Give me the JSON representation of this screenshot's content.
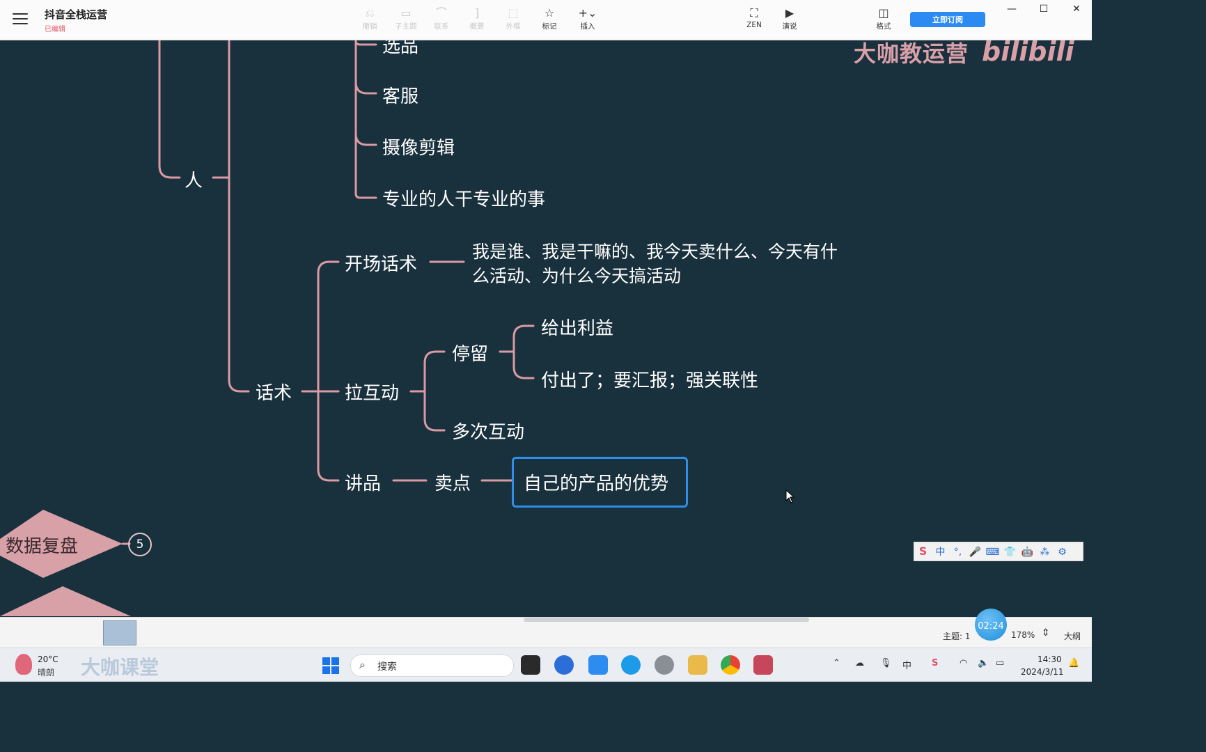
{
  "app": {
    "title": "抖音全栈运营",
    "status": "已编辑",
    "subscribe_label": "立即订阅"
  },
  "toolbar": {
    "items": [
      {
        "label": "撤销",
        "icon": "undo-icon",
        "glyph": "⎌"
      },
      {
        "label": "子主题",
        "icon": "subtopic-icon",
        "glyph": "▭"
      },
      {
        "label": "联系",
        "icon": "relation-icon",
        "glyph": "⌒"
      },
      {
        "label": "概要",
        "icon": "summary-icon",
        "glyph": "]"
      },
      {
        "label": "外框",
        "icon": "boundary-icon",
        "glyph": "⬚"
      },
      {
        "label": "标记",
        "icon": "star-icon",
        "glyph": "☆"
      },
      {
        "label": "插入",
        "icon": "plus-icon",
        "glyph": "+⌄"
      },
      {
        "label": "ZEN",
        "icon": "zen-fullscreen-icon",
        "glyph": "⛶"
      },
      {
        "label": "演说",
        "icon": "present-icon",
        "glyph": "▶"
      },
      {
        "label": "格式",
        "icon": "format-panel-icon",
        "glyph": "◫"
      }
    ]
  },
  "watermark": {
    "text": "大咖教运营",
    "brand": "bilibili"
  },
  "mindmap": {
    "ren": "人",
    "ren_children": [
      "选品",
      "客服",
      "摄像剪辑",
      "专业的人干专业的事"
    ],
    "huashu": "话术",
    "kaichang": "开场话术",
    "kaichang_line1": "我是谁、我是干嘛的、我今天卖什么、今天有什",
    "kaichang_line2": "么活动、为什么今天搞活动",
    "hudong": "拉互动",
    "tingliu": "停留",
    "tingliu_children": [
      "给出利益",
      "付出了；要汇报；强关联性"
    ],
    "duoci": "多次互动",
    "jiangpin": "讲品",
    "maidian": "卖点",
    "youshi": "自己的产品的优势",
    "shuju": "数据复盘",
    "shuju_count": "5"
  },
  "ime_toolbar": {
    "mode": "中",
    "items": [
      "中",
      "°,",
      "🎤",
      "⌨",
      "👕",
      "🤖",
      "⁂",
      "⚙"
    ]
  },
  "statusbar": {
    "theme_label": "主题: 1",
    "zoom": "178%",
    "outline_label": "大纲",
    "timer": "02:24"
  },
  "taskbar": {
    "temperature": "20°C",
    "weather": "晴朗",
    "brand_text": "大咖课堂",
    "search_placeholder": "搜索",
    "time": "14:30",
    "date": "2024/3/11"
  },
  "colors": {
    "canvas_bg": "#19303d",
    "branch": "#d99aa4",
    "node_text": "#ffffff",
    "selection": "#2f8fe6",
    "diamond": "#d8a1a8"
  }
}
